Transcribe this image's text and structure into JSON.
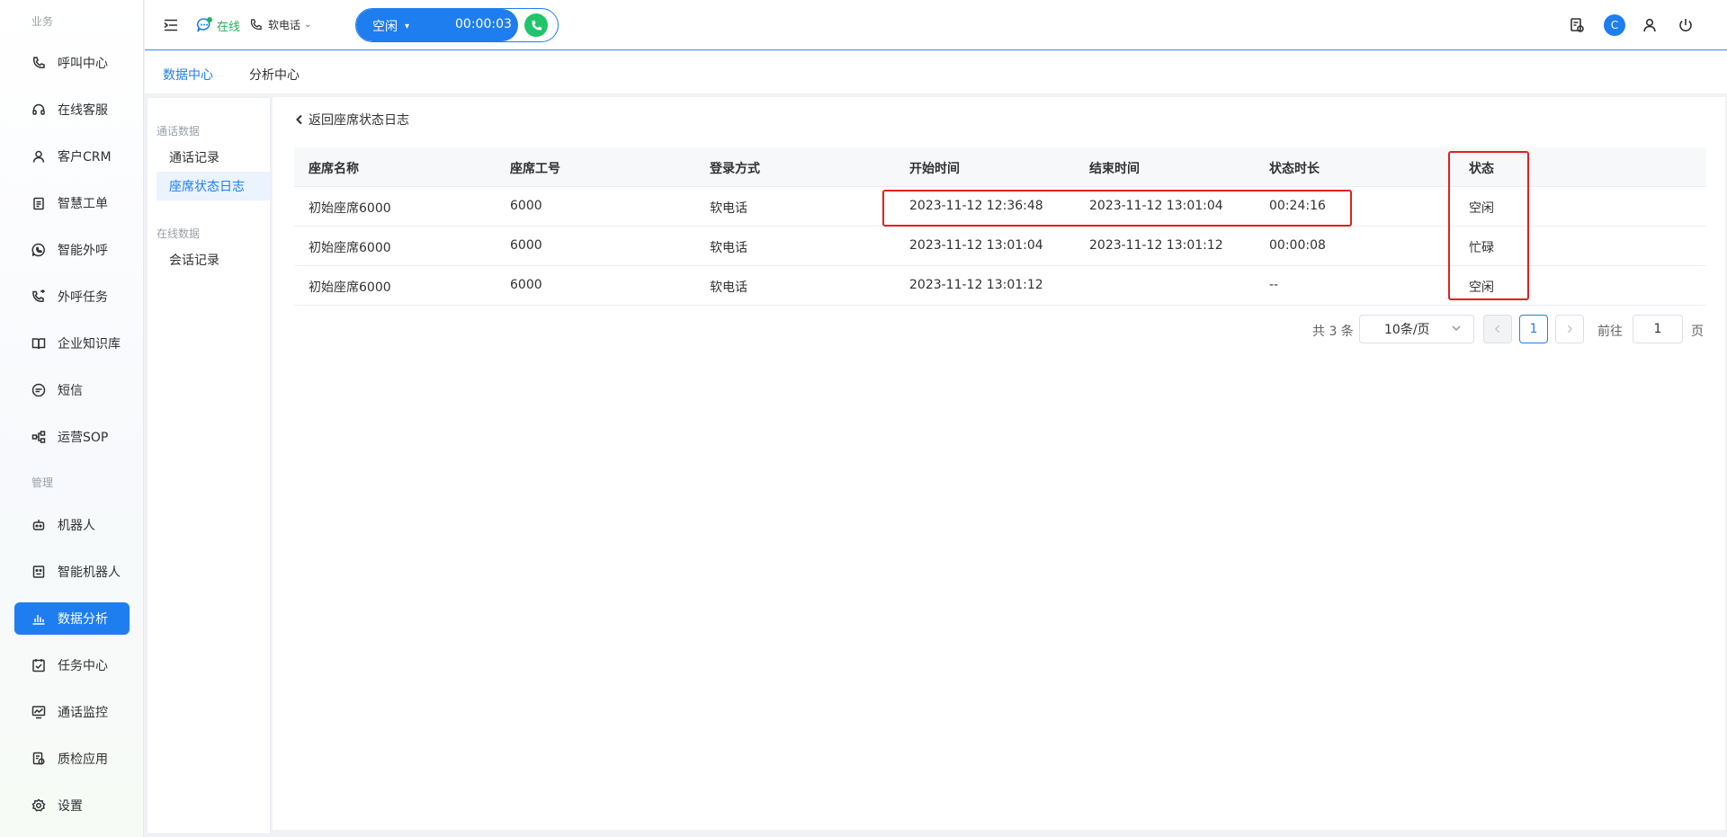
{
  "sidebar": {
    "section_business": "业务",
    "section_manage": "管理",
    "items": [
      {
        "label": "呼叫中心",
        "icon": "phone-icon"
      },
      {
        "label": "在线客服",
        "icon": "headset-icon"
      },
      {
        "label": "客户CRM",
        "icon": "user-icon"
      },
      {
        "label": "智慧工单",
        "icon": "clipboard-icon"
      },
      {
        "label": "智能外呼",
        "icon": "chat-phone-icon"
      },
      {
        "label": "外呼任务",
        "icon": "phone-forward-icon"
      },
      {
        "label": "企业知识库",
        "icon": "book-icon"
      },
      {
        "label": "短信",
        "icon": "sms-icon"
      },
      {
        "label": "运营SOP",
        "icon": "flow-icon"
      },
      {
        "label": "机器人",
        "icon": "robot-icon"
      },
      {
        "label": "智能机器人",
        "icon": "smart-robot-icon"
      },
      {
        "label": "数据分析",
        "icon": "bar-chart-icon"
      },
      {
        "label": "任务中心",
        "icon": "task-icon"
      },
      {
        "label": "通话监控",
        "icon": "monitor-icon"
      },
      {
        "label": "质检应用",
        "icon": "quality-icon"
      },
      {
        "label": "设置",
        "icon": "gear-icon"
      }
    ],
    "active_index": 11
  },
  "header": {
    "online_status": "在线",
    "phone_mode": "软电话",
    "agent_state": "空闲",
    "timer": "00:00:03",
    "avatar_letter": "C",
    "accent_color": "#1e7ef0"
  },
  "topnav": {
    "tabs": [
      "数据中心",
      "分析中心"
    ],
    "active_index": 0
  },
  "submenu": {
    "group1": "通话数据",
    "group1_items": [
      "通话记录",
      "座席状态日志"
    ],
    "group2": "在线数据",
    "group2_items": [
      "会话记录"
    ],
    "active": "座席状态日志"
  },
  "content": {
    "back_label": "返回座席状态日志",
    "columns": [
      "座席名称",
      "座席工号",
      "登录方式",
      "开始时间",
      "结束时间",
      "状态时长",
      "状态"
    ],
    "rows": [
      [
        "初始座席6000",
        "6000",
        "软电话",
        "2023-11-12 12:36:48",
        "2023-11-12 13:01:04",
        "00:24:16",
        "空闲"
      ],
      [
        "初始座席6000",
        "6000",
        "软电话",
        "2023-11-12 13:01:04",
        "2023-11-12 13:01:12",
        "00:00:08",
        "忙碌"
      ],
      [
        "初始座席6000",
        "6000",
        "软电话",
        "2023-11-12 13:01:12",
        "",
        "--",
        "空闲"
      ]
    ]
  },
  "pager": {
    "total": "共 3 条",
    "page_size": "10条/页",
    "current_page": "1",
    "goto_label": "前往",
    "goto_value": "1",
    "page_suffix": "页"
  },
  "highlight_color": "#e02020"
}
